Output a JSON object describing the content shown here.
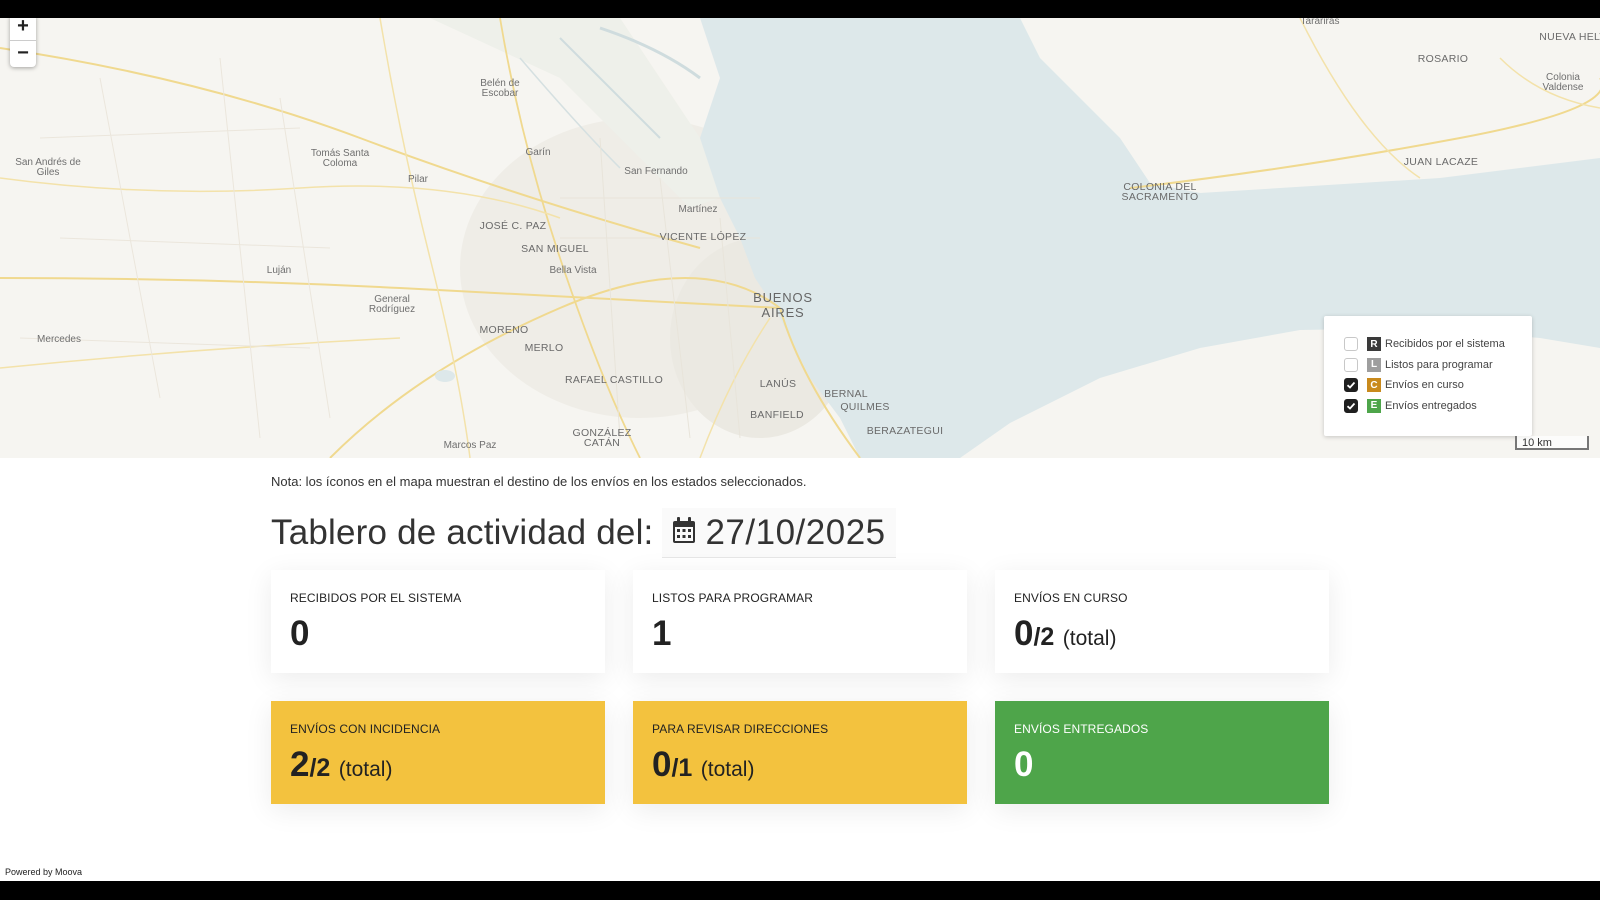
{
  "map": {
    "zoom_in": "+",
    "zoom_out": "−",
    "scale_label": "10 km",
    "labels": {
      "tarariras": "Tarariras",
      "nueva_helvecia": "NUEVA HELV",
      "rosario": "ROSARIO",
      "colonia_valdense_1": "Colonia",
      "colonia_valdense_2": "Valdense",
      "juan_lacaze": "JUAN LACAZE",
      "colonia_sacramento_1": "COLONIA DEL",
      "colonia_sacramento_2": "SACRAMENTO",
      "belen_escobar_1": "Belén de",
      "belen_escobar_2": "Escobar",
      "san_andres_giles_1": "San Andrés de",
      "san_andres_giles_2": "Giles",
      "tomas_santa_coloma_1": "Tomás Santa",
      "tomas_santa_coloma_2": "Coloma",
      "garin": "Garín",
      "pilar": "Pilar",
      "san_fernando": "San Fernando",
      "martinez": "Martínez",
      "jose_c_paz": "JOSÉ C. PAZ",
      "vicente_lopez": "VICENTE LÓPEZ",
      "san_miguel": "SAN MIGUEL",
      "bella_vista": "Bella Vista",
      "lujan": "Luján",
      "buenos_aires_1": "BUENOS",
      "buenos_aires_2": "AIRES",
      "general_rodriguez_1": "General",
      "general_rodriguez_2": "Rodríguez",
      "moreno": "MORENO",
      "mercedes": "Mercedes",
      "merlo": "MERLO",
      "rafael_castillo": "RAFAEL CASTILLO",
      "lanus": "LANÚS",
      "bernal": "BERNAL",
      "quilmes": "QUILMES",
      "banfield": "BANFIELD",
      "gonzalez_catan_1": "GONZÁLEZ",
      "gonzalez_catan_2": "CATÁN",
      "berazategui": "BERAZATEGUI",
      "marcos_paz": "Marcos Paz"
    },
    "legend": [
      {
        "badge": "R",
        "label": "Recibidos por el sistema",
        "checked": false,
        "color": "#3a3a3a"
      },
      {
        "badge": "L",
        "label": "Listos para programar",
        "checked": false,
        "color": "#9e9e9e"
      },
      {
        "badge": "C",
        "label": "Envíos en curso",
        "checked": true,
        "color": "#c98a1d"
      },
      {
        "badge": "E",
        "label": "Envíos entregados",
        "checked": true,
        "color": "#4ea54a"
      }
    ]
  },
  "note": "Nota: los íconos en el mapa muestran el destino de los envíos en los estados seleccionados.",
  "dashboard": {
    "title": "Tablero de actividad del:",
    "date": "27/10/2025"
  },
  "cards": {
    "recibidos": {
      "title": "RECIBIDOS POR EL SISTEMA",
      "value": "0"
    },
    "listos": {
      "title": "LISTOS PARA PROGRAMAR",
      "value": "1"
    },
    "en_curso": {
      "title": "ENVÍOS EN CURSO",
      "value": "0",
      "total": "/2",
      "suffix": "(total)"
    },
    "incidencia": {
      "title": "ENVÍOS CON INCIDENCIA",
      "value": "2",
      "total": "/2",
      "suffix": "(total)"
    },
    "direcciones": {
      "title": "PARA REVISAR DIRECCIONES",
      "value": "0",
      "total": "/1",
      "suffix": "(total)"
    },
    "entregados": {
      "title": "ENVÍOS ENTREGADOS",
      "value": "0"
    }
  },
  "colors": {
    "yellow_card": "#f3c23e",
    "green_card": "#4ea54a",
    "water": "#dde8ea",
    "land": "#f6f5f1"
  },
  "footer": {
    "powered": "Powered by Moova"
  }
}
